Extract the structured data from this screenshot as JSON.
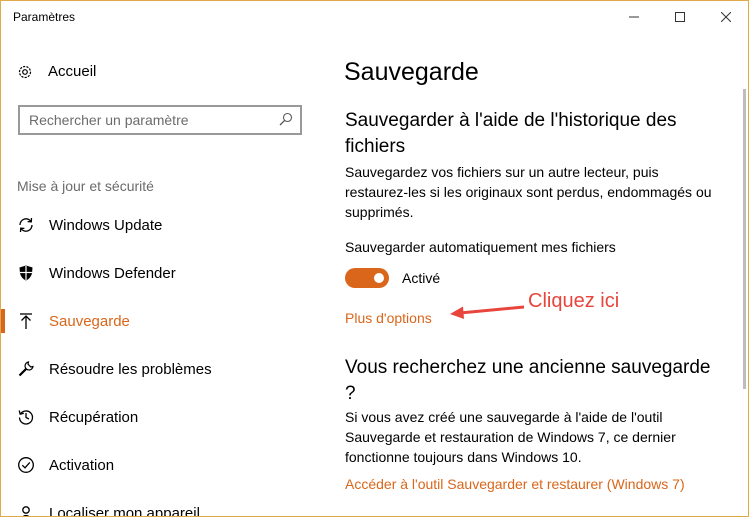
{
  "window": {
    "title": "Paramètres",
    "controls": {
      "minimize": "—",
      "maximize": "☐",
      "close": "✕"
    }
  },
  "sidebar": {
    "home_label": "Accueil",
    "search_placeholder": "Rechercher un paramètre",
    "section_label": "Mise à jour et sécurité",
    "items": [
      {
        "label": "Windows Update",
        "icon": "sync-icon"
      },
      {
        "label": "Windows Defender",
        "icon": "shield-icon"
      },
      {
        "label": "Sauvegarde",
        "icon": "upload-arrow-icon",
        "active": true
      },
      {
        "label": "Résoudre les problèmes",
        "icon": "wrench-icon"
      },
      {
        "label": "Récupération",
        "icon": "history-icon"
      },
      {
        "label": "Activation",
        "icon": "check-circle-icon"
      },
      {
        "label": "Localiser mon appareil",
        "icon": "person-pin-icon"
      }
    ]
  },
  "main": {
    "page_title": "Sauvegarde",
    "history": {
      "heading": "Sauvegarder à l'aide de l'historique des fichiers",
      "description": "Sauvegardez vos fichiers sur un autre lecteur, puis restaurez-les si les originaux sont perdus, endommagés ou supprimés.",
      "toggle_label": "Sauvegarder automatiquement mes fichiers",
      "toggle_state": "Activé",
      "toggle_on": true,
      "more_options_link": "Plus d'options"
    },
    "old_backup": {
      "heading": "Vous recherchez une ancienne sauvegarde ?",
      "description": "Si vous avez créé une sauvegarde à l'aide de l'outil Sauvegarde et restauration de Windows 7, ce dernier fonctionne toujours dans Windows 10.",
      "link": "Accéder à l'outil Sauvegarder et restaurer (Windows 7)"
    },
    "annotation": "Cliquez ici"
  },
  "colors": {
    "accent": "#d9661a",
    "annotation": "#e8453c",
    "window_border": "#e0a94a"
  }
}
